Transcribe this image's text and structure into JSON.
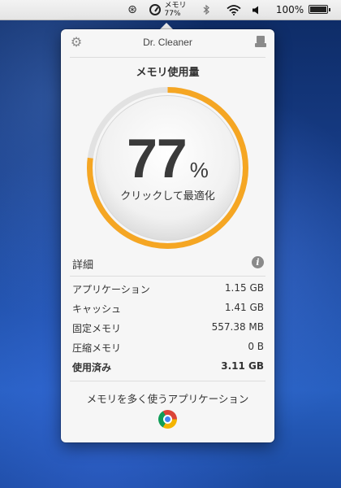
{
  "menubar": {
    "memory_label": "メモリ",
    "memory_pct": "77%",
    "battery_pct": "100%",
    "battery_level": 1.0
  },
  "popup": {
    "app_name": "Dr. Cleaner",
    "section_title": "メモリ使用量",
    "usage_value": "77",
    "usage_unit": "%",
    "usage_fraction": 0.77,
    "optimize_label": "クリックして最適化",
    "details_title": "詳細",
    "details": [
      {
        "label": "アプリケーション",
        "value": "1.15 GB"
      },
      {
        "label": "キャッシュ",
        "value": "1.41 GB"
      },
      {
        "label": "固定メモリ",
        "value": "557.38 MB"
      },
      {
        "label": "圧縮メモリ",
        "value": "0 B"
      },
      {
        "label": "使用済み",
        "value": "3.11 GB"
      }
    ],
    "top_apps_title": "メモリを多く使うアプリケーション",
    "top_apps": [
      "chrome-icon"
    ],
    "accent_color": "#f5a623"
  }
}
